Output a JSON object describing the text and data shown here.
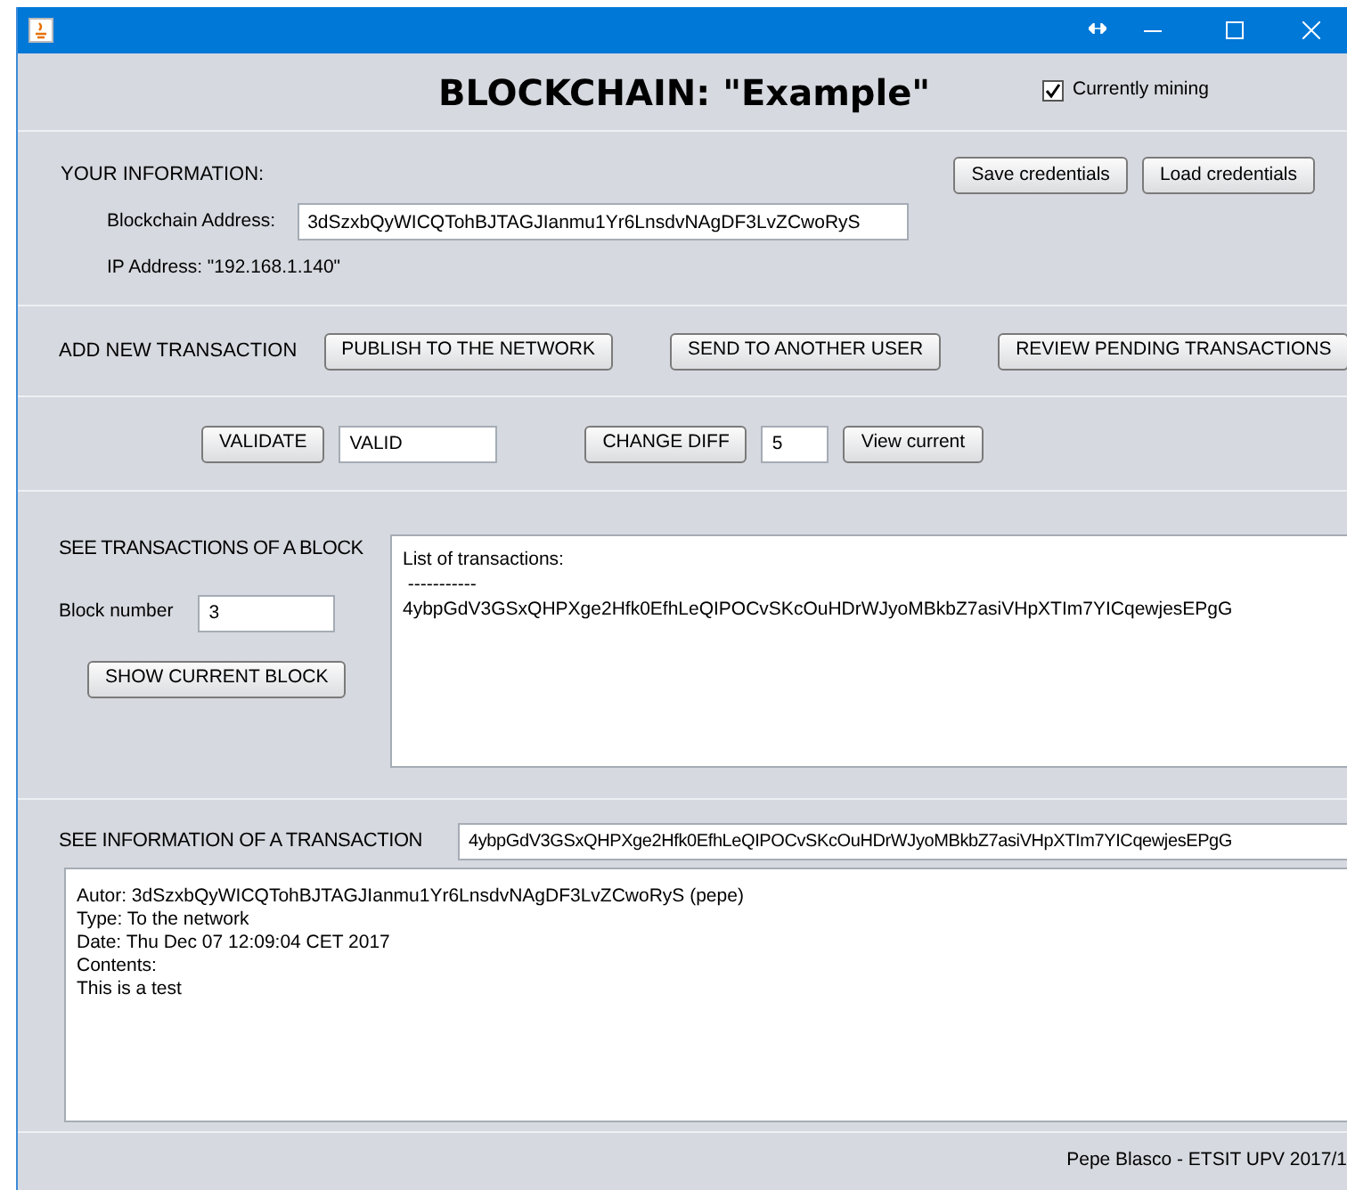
{
  "header": {
    "title": "BLOCKCHAIN: \"Example\"",
    "mining": {
      "label": "Currently mining",
      "checked": true
    }
  },
  "your_information": {
    "heading": "YOUR INFORMATION:",
    "buttons": [
      "Save credentials",
      "Load credentials"
    ],
    "address_label": "Blockchain Address:",
    "address_value": "3dSzxbQyWICQTohBJTAGJIanmu1Yr6LnsdvNAgDF3LvZCwoRyS",
    "ip": "IP Address: \"192.168.1.140\""
  },
  "add_transaction": {
    "heading": "ADD NEW TRANSACTION",
    "buttons": [
      "PUBLISH TO THE NETWORK",
      "SEND TO ANOTHER USER",
      "REVIEW PENDING TRANSACTIONS"
    ]
  },
  "validation": {
    "validate_button": "VALIDATE",
    "validate_value": "VALID",
    "diff_button": "CHANGE DIFF",
    "diff_value": "5",
    "view_button": "View current"
  },
  "block": {
    "heading": "SEE TRANSACTIONS OF A BLOCK",
    "number_label": "Block number",
    "number_value": "3",
    "show_button": "SHOW CURRENT BLOCK",
    "list_lines": [
      "List of transactions:",
      " -----------",
      "4ybpGdV3GSxQHPXge2Hfk0EfhLeQIPOCvSKcOuHDrWJyoMBkbZ7asiVHpXTIm7YICqewjesEPgG"
    ]
  },
  "transaction": {
    "heading": "SEE INFORMATION OF A TRANSACTION",
    "id_value": "4ybpGdV3GSxQHPXge2Hfk0EfhLeQIPOCvSKcOuHDrWJyoMBkbZ7asiVHpXTIm7YICqewjesEPgG",
    "info_lines": [
      "Autor: 3dSzxbQyWICQTohBJTAGJIanmu1Yr6LnsdvNAgDF3LvZCwoRyS (pepe)",
      "Type: To the network",
      "Date: Thu Dec 07 12:09:04 CET 2017",
      "Contents:",
      "This is a test"
    ]
  },
  "footer": "Pepe Blasco - ETSIT UPV 2017/1"
}
